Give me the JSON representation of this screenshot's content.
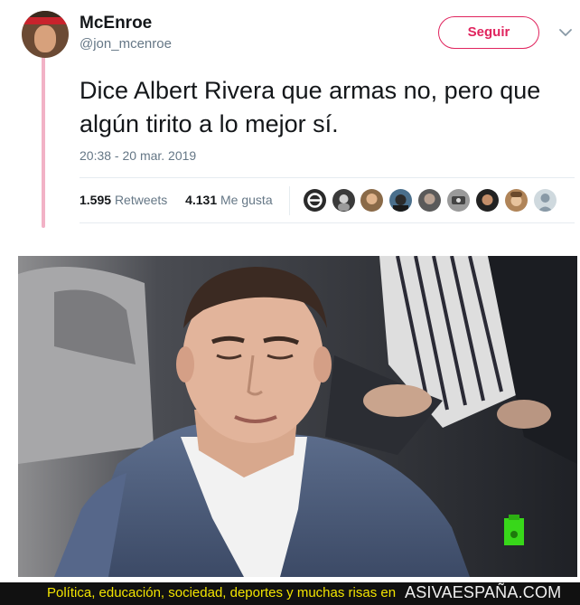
{
  "tweet": {
    "name": "McEnroe",
    "handle": "@jon_mcenroe",
    "follow_label": "Seguir",
    "text": "Dice Albert Rivera que armas no, pero que algún tirito a lo mejor sí.",
    "timestamp": "20:38 - 20 mar. 2019",
    "retweets_count": "1.595",
    "retweets_label": "Retweets",
    "likes_count": "4.131",
    "likes_label": "Me gusta",
    "liker_avatar_count": 9
  },
  "colors": {
    "accent": "#e0245e",
    "text": "#14171a",
    "muted": "#657786",
    "thread_line": "#f2b2c6",
    "footer_text": "#f2e400"
  },
  "footer": {
    "tagline": "Política, educación, sociedad, deportes y muchas risas en",
    "site": "ASIVAESPAÑA.COM"
  },
  "icons": {
    "follow_menu": "chevron-down-icon",
    "broadcast_watermark": "tv-channel-logo-icon"
  }
}
